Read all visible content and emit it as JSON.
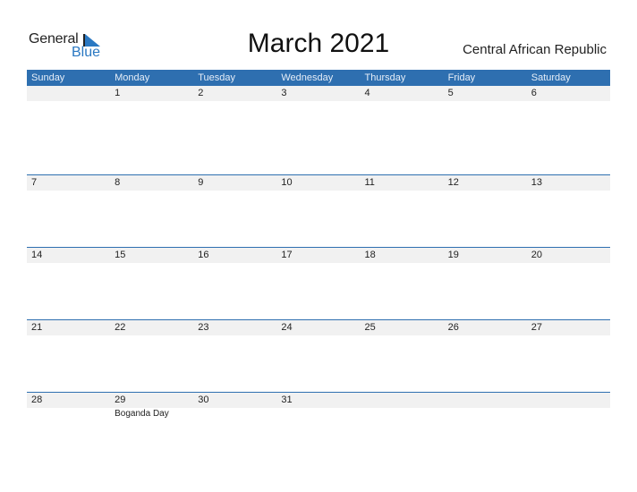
{
  "logo": {
    "word1": "General",
    "word2": "Blue"
  },
  "title": "March 2021",
  "country": "Central African Republic",
  "weekdays": [
    "Sunday",
    "Monday",
    "Tuesday",
    "Wednesday",
    "Thursday",
    "Friday",
    "Saturday"
  ],
  "weeks": [
    {
      "days": [
        "",
        "1",
        "2",
        "3",
        "4",
        "5",
        "6"
      ],
      "notes": [
        "",
        "",
        "",
        "",
        "",
        "",
        ""
      ]
    },
    {
      "days": [
        "7",
        "8",
        "9",
        "10",
        "11",
        "12",
        "13"
      ],
      "notes": [
        "",
        "",
        "",
        "",
        "",
        "",
        ""
      ]
    },
    {
      "days": [
        "14",
        "15",
        "16",
        "17",
        "18",
        "19",
        "20"
      ],
      "notes": [
        "",
        "",
        "",
        "",
        "",
        "",
        ""
      ]
    },
    {
      "days": [
        "21",
        "22",
        "23",
        "24",
        "25",
        "26",
        "27"
      ],
      "notes": [
        "",
        "",
        "",
        "",
        "",
        "",
        ""
      ]
    },
    {
      "days": [
        "28",
        "29",
        "30",
        "31",
        "",
        "",
        ""
      ],
      "notes": [
        "",
        "Boganda Day",
        "",
        "",
        "",
        "",
        ""
      ]
    }
  ],
  "colors": {
    "accent": "#2e6fb0",
    "row_bg": "#f1f1f1",
    "logo_blue": "#2a78c2"
  }
}
